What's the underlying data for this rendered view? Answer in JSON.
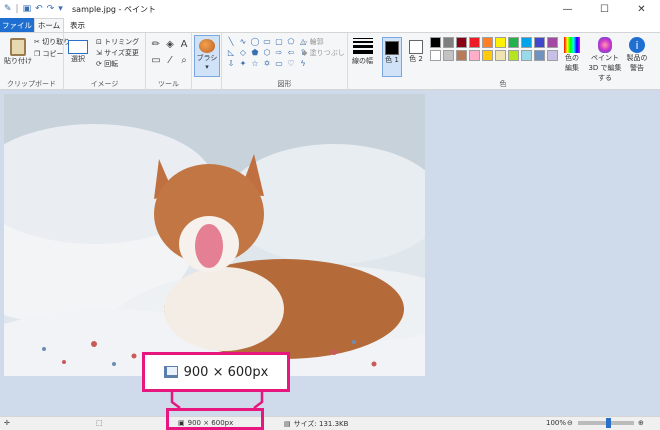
{
  "window": {
    "title": "sample.jpg - ペイント"
  },
  "quick_access": [
    "save-icon",
    "undo-icon",
    "redo-icon"
  ],
  "tabs": {
    "file": "ファイル",
    "home": "ホーム",
    "view": "表示"
  },
  "ribbon": {
    "clipboard": {
      "paste": "貼り付け",
      "cut": "切り取り",
      "copy": "コピー",
      "label": "クリップボード"
    },
    "image": {
      "select": "選択",
      "crop": "トリミング",
      "resize": "サイズ変更",
      "rotate": "回転",
      "label": "イメージ"
    },
    "tools": {
      "label": "ツール"
    },
    "brush": {
      "label": "ブラシ"
    },
    "shapes": {
      "outline": "輪郭",
      "fill": "塗りつぶし",
      "label": "図形"
    },
    "line_width": "線の幅",
    "color1": "色 1",
    "color2": "色 2",
    "edit_colors": "色の編集",
    "paint3d": "ペイント 3D で編集する",
    "product_alert": "製品の警告",
    "colors_label": "色",
    "palette": [
      "#000000",
      "#7f7f7f",
      "#880015",
      "#ed1c24",
      "#ff7f27",
      "#fff200",
      "#22b14c",
      "#00a2e8",
      "#3f48cc",
      "#a349a4",
      "#ffffff",
      "#c3c3c3",
      "#b97a57",
      "#ffaec9",
      "#ffc90e",
      "#efe4b0",
      "#b5e61d",
      "#99d9ea",
      "#7092be",
      "#c8bfe7"
    ]
  },
  "callout": {
    "dimensions": "900 × 600px"
  },
  "status": {
    "dimensions": "900 × 600px",
    "size": "サイズ: 131.3KB",
    "zoom": "100%"
  }
}
